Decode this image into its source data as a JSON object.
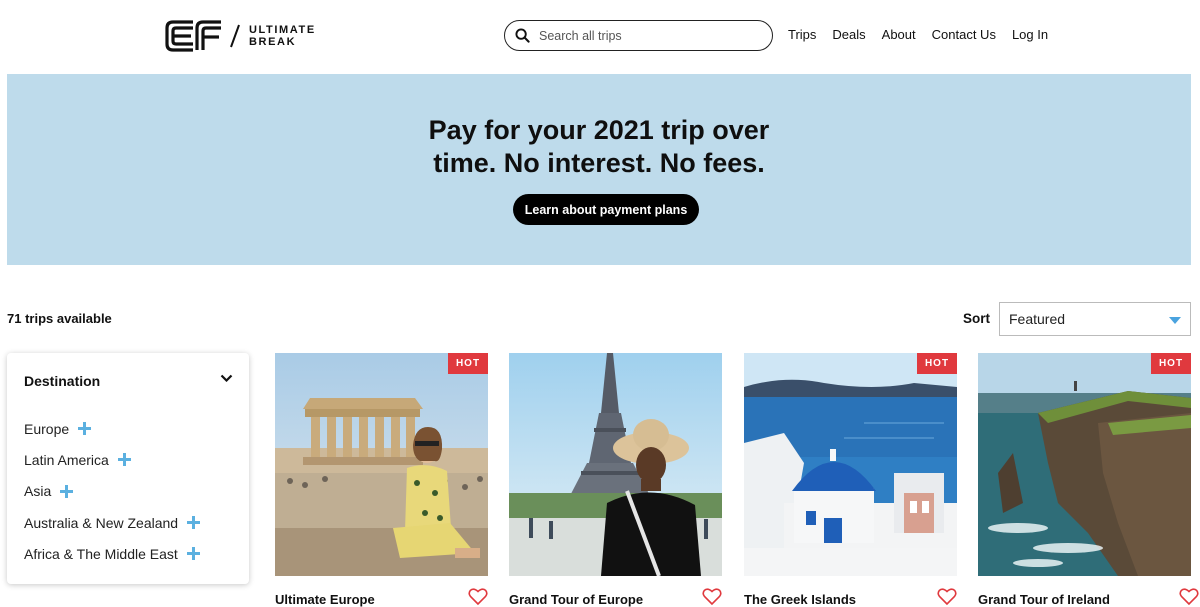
{
  "header": {
    "logo_text": [
      "ULTIMATE",
      "BREAK"
    ],
    "search_placeholder": "Search all trips",
    "nav": [
      "Trips",
      "Deals",
      "About",
      "Contact Us",
      "Log In"
    ]
  },
  "banner": {
    "headline": [
      "Pay for your 2021 trip over",
      "time. No interest. No fees."
    ],
    "cta": "Learn about payment plans"
  },
  "results": {
    "count_text": "71 trips available",
    "sort_label": "Sort",
    "sort_value": "Featured"
  },
  "filter": {
    "title": "Destination",
    "items": [
      "Europe",
      "Latin America",
      "Asia",
      "Australia & New Zealand",
      "Africa & The Middle East"
    ]
  },
  "cards": [
    {
      "title": "Ultimate Europe",
      "badge": "HOT"
    },
    {
      "title": "Grand Tour of Europe",
      "badge": ""
    },
    {
      "title": "The Greek Islands",
      "badge": "HOT"
    },
    {
      "title": "Grand Tour of Ireland",
      "badge": "HOT"
    }
  ],
  "colors": {
    "banner_bg": "#bedbeb",
    "badge": "#e0393e",
    "heart": "#e0393e",
    "accent": "#4aa3df"
  }
}
